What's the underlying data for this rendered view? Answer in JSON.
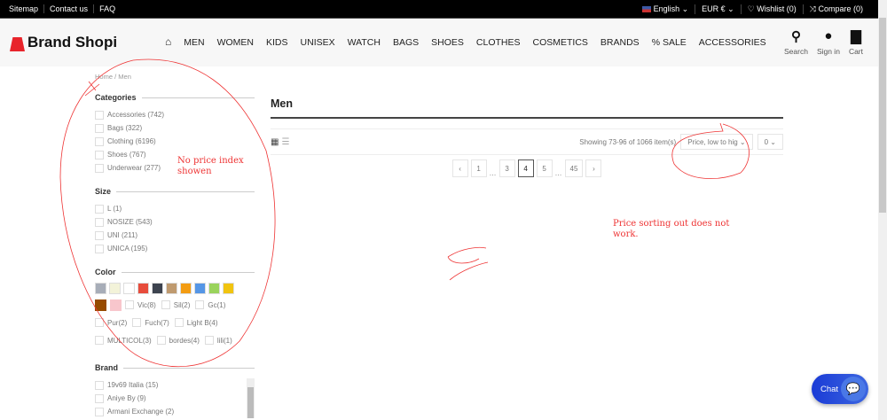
{
  "topbar": {
    "links": [
      "Sitemap",
      "Contact us",
      "FAQ"
    ],
    "language": "English",
    "currency": "EUR €",
    "wishlist": "Wishlist (0)",
    "compare": "Compare (0)"
  },
  "header": {
    "logo": "Brand Shopi",
    "nav": [
      "MEN",
      "WOMEN",
      "KIDS",
      "UNISEX",
      "WATCH",
      "BAGS",
      "SHOES",
      "CLOTHES",
      "COSMETICS",
      "BRANDS",
      "% SALE",
      "ACCESSORIES"
    ],
    "search": "Search",
    "signin": "Sign in",
    "cart": "Cart"
  },
  "breadcrumb": [
    "Home",
    "Men"
  ],
  "filters": {
    "categories_title": "Categories",
    "categories": [
      "Accessories (742)",
      "Bags (322)",
      "Clothing (6196)",
      "Shoes (767)",
      "Underwear (277)"
    ],
    "size_title": "Size",
    "sizes": [
      "L (1)",
      "NOSIZE (543)",
      "UNI (211)",
      "UNICA (195)"
    ],
    "color_title": "Color",
    "swatches": [
      "#a7adb8",
      "#f3f3d9",
      "#ffffff",
      "#e74c3c",
      "#3d434f",
      "#bf9a6f",
      "#f39c12",
      "#5596e6",
      "#9ad35c",
      "#f1c40f",
      "#974b00",
      "#f8c6cc"
    ],
    "color_labels": [
      "Vic(8)",
      "Sil(2)",
      "Gc(1)",
      "Pur(2)",
      "Fuch(7)",
      "Light B(4)",
      "MULTICOL(3)",
      "bordes(4)",
      "lili(1)"
    ],
    "brand_title": "Brand",
    "brands": [
      "19v69 Italia (15)",
      "Aniye By (9)",
      "Armani Exchange (2)"
    ]
  },
  "main": {
    "title": "Men",
    "showing": "Showing 73-96 of 1066 item(s)",
    "sort": "Price, low to hig",
    "per_page": "0",
    "pages": [
      "‹",
      "1",
      "…",
      "3",
      "4",
      "5",
      "…",
      "45",
      "›"
    ],
    "current_page": "4"
  },
  "annotations": {
    "left": "No price index showen",
    "right": "Price sorting out does not work."
  },
  "chat": "Chat"
}
